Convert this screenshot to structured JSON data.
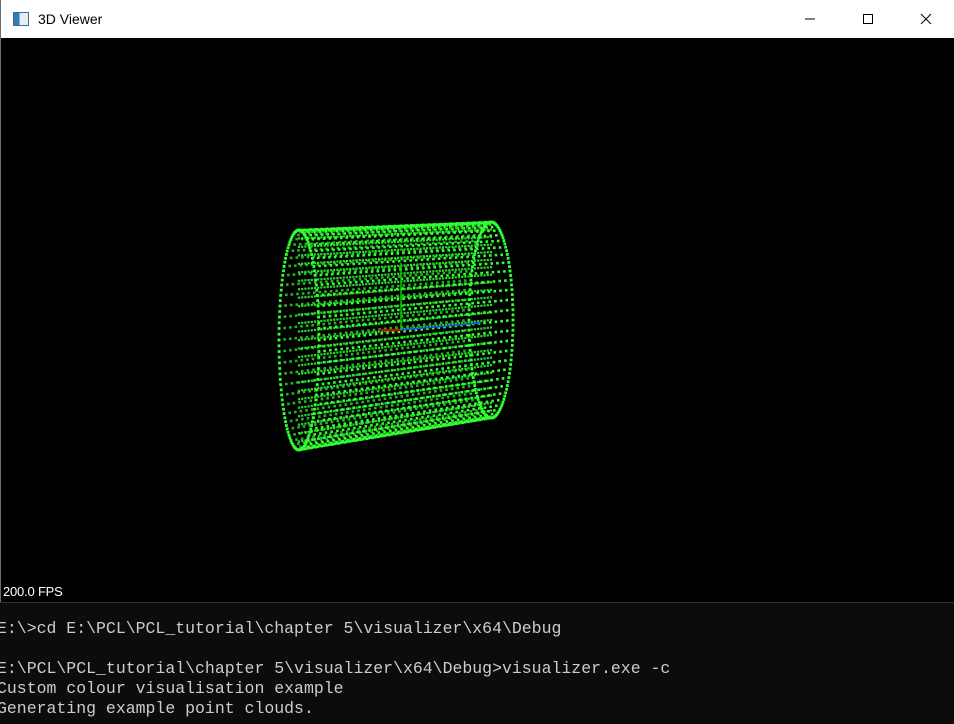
{
  "window": {
    "title": "3D Viewer",
    "icon": "app-window-icon"
  },
  "caption_buttons": {
    "minimize": "minimize-icon",
    "maximize": "maximize-icon",
    "close": "close-icon"
  },
  "viewer": {
    "fps_text": "200.0 FPS",
    "point_color": "#33ff33",
    "background_color": "#000000",
    "axes": {
      "x_color": "#cc0000",
      "y_color": "#00cc00",
      "z_color": "#2244ff"
    }
  },
  "console": {
    "lines": [
      "E:\\>cd E:\\PCL\\PCL_tutorial\\chapter 5\\visualizer\\x64\\Debug",
      "",
      "E:\\PCL\\PCL_tutorial\\chapter 5\\visualizer\\x64\\Debug>visualizer.exe -c",
      "Custom colour visualisation example",
      "Generating example point clouds."
    ]
  }
}
